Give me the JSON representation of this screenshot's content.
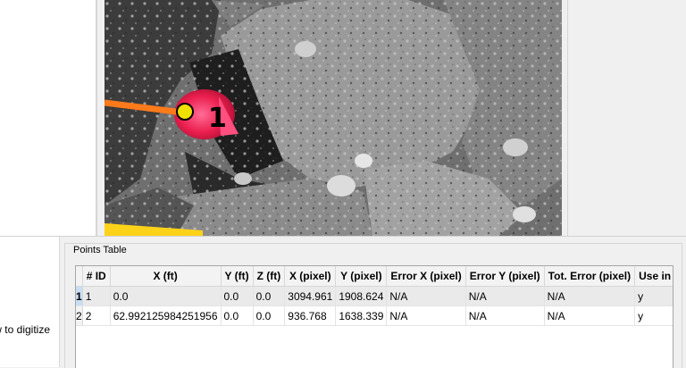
{
  "points_table": {
    "title": "Points Table",
    "columns": [
      "",
      "# ID",
      "X (ft)",
      "Y (ft)",
      "Z (ft)",
      "X (pixel)",
      "Y (pixel)",
      "Error X (pixel)",
      "Error Y (pixel)",
      "Tot. Error (pixel)",
      "Use in R"
    ],
    "rows": [
      {
        "header": "1",
        "id": "1",
        "x_ft": "0.0",
        "y_ft": "0.0",
        "z_ft": "0.0",
        "x_px": "3094.961",
        "y_px": "1908.624",
        "err_x": "N/A",
        "err_y": "N/A",
        "tot_err": "N/A",
        "use": "y"
      },
      {
        "header": "2",
        "id": "2",
        "x_ft": "62.992125984251956",
        "y_ft": "0.0",
        "z_ft": "0.0",
        "x_px": "936.768",
        "y_px": "1638.339",
        "err_x": "N/A",
        "err_y": "N/A",
        "tot_err": "N/A",
        "use": "y"
      }
    ]
  },
  "left_panel": {
    "hint_text": "w to digitize"
  },
  "image_view": {
    "marker_label": "1",
    "marker_color": "#f0e000",
    "line_color": "#ff7a1a",
    "bar_color": "#ffd21a",
    "target_color": "#ff2f6a"
  }
}
